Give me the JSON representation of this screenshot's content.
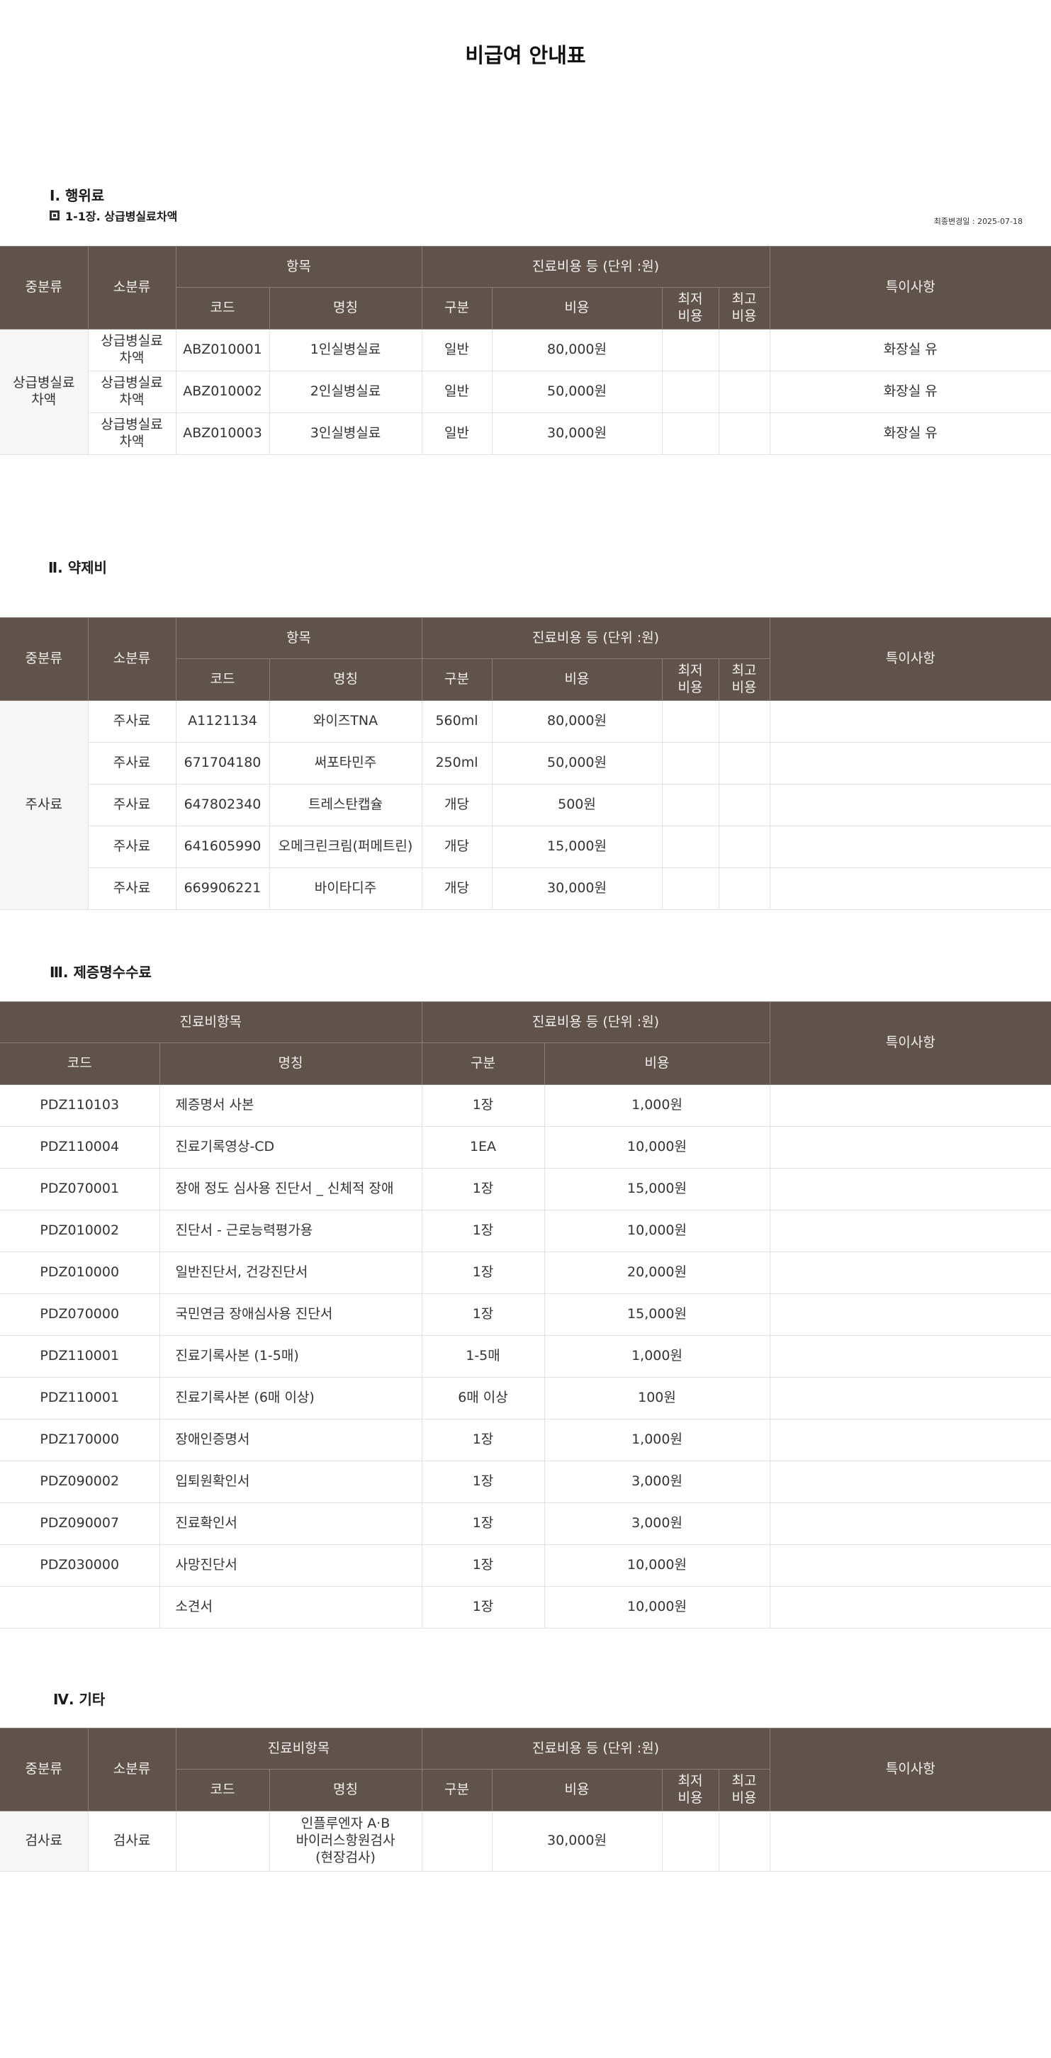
{
  "title": "비급여 안내표",
  "updated": "최종변경일 : 2025-07-18",
  "sec1": {
    "heading": "Ⅰ. 행위료",
    "sub": "1-1장. 상급병실료차액",
    "h": {
      "mid": "중분류",
      "small": "소분류",
      "item": "항목",
      "cost": "진료비용 등 (단위 :원)",
      "note": "특이사항",
      "code": "코드",
      "name": "명칭",
      "div": "구분",
      "price": "비용",
      "min": "최저\n비용",
      "max": "최고\n비용"
    },
    "group": "상급병실료\n차액",
    "rows": [
      {
        "small": "상급병실료\n차액",
        "code": "ABZ010001",
        "name": "1인실병실료",
        "div": "일반",
        "price": "80,000원",
        "note": "화장실 유"
      },
      {
        "small": "상급병실료\n차액",
        "code": "ABZ010002",
        "name": "2인실병실료",
        "div": "일반",
        "price": "50,000원",
        "note": "화장실 유"
      },
      {
        "small": "상급병실료\n차액",
        "code": "ABZ010003",
        "name": "3인실병실료",
        "div": "일반",
        "price": "30,000원",
        "note": "화장실 유"
      }
    ]
  },
  "sec2": {
    "heading": "Ⅱ. 약제비",
    "h": {
      "mid": "중분류",
      "small": "소분류",
      "item": "항목",
      "cost": "진료비용 등 (단위 :원)",
      "note": "특이사항",
      "code": "코드",
      "name": "명칭",
      "div": "구분",
      "price": "비용",
      "min": "최저\n비용",
      "max": "최고\n비용"
    },
    "group": "주사료",
    "rows": [
      {
        "small": "주사료",
        "code": "A1121134",
        "name": "와이즈TNA",
        "div": "560ml",
        "price": "80,000원"
      },
      {
        "small": "주사료",
        "code": "671704180",
        "name": "써포타민주",
        "div": "250ml",
        "price": "50,000원"
      },
      {
        "small": "주사료",
        "code": "647802340",
        "name": "트레스탄캡슐",
        "div": "개당",
        "price": "500원"
      },
      {
        "small": "주사료",
        "code": "641605990",
        "name": "오메크린크림(퍼메트린)",
        "div": "개당",
        "price": "15,000원"
      },
      {
        "small": "주사료",
        "code": "669906221",
        "name": "바이타디주",
        "div": "개당",
        "price": "30,000원"
      }
    ]
  },
  "sec3": {
    "heading": "Ⅲ. 제증명수수료",
    "h": {
      "item": "진료비항목",
      "cost": "진료비용 등 (단위 :원)",
      "note": "특이사항",
      "code": "코드",
      "name": "명칭",
      "div": "구분",
      "price": "비용"
    },
    "rows": [
      {
        "code": "PDZ110103",
        "name": "제증명서 사본",
        "div": "1장",
        "price": "1,000원"
      },
      {
        "code": "PDZ110004",
        "name": "진료기록영상-CD",
        "div": "1EA",
        "price": "10,000원"
      },
      {
        "code": "PDZ070001",
        "name": "장애 정도 심사용 진단서 _ 신체적 장애",
        "div": "1장",
        "price": "15,000원"
      },
      {
        "code": "PDZ010002",
        "name": "진단서 - 근로능력평가용",
        "div": "1장",
        "price": "10,000원"
      },
      {
        "code": "PDZ010000",
        "name": "일반진단서, 건강진단서",
        "div": "1장",
        "price": "20,000원"
      },
      {
        "code": "PDZ070000",
        "name": "국민연금 장애심사용 진단서",
        "div": "1장",
        "price": "15,000원"
      },
      {
        "code": "PDZ110001",
        "name": "진료기록사본 (1-5매)",
        "div": "1-5매",
        "price": "1,000원"
      },
      {
        "code": "PDZ110001",
        "name": "진료기록사본 (6매 이상)",
        "div": "6매 이상",
        "price": "100원"
      },
      {
        "code": "PDZ170000",
        "name": "장애인증명서",
        "div": "1장",
        "price": "1,000원"
      },
      {
        "code": "PDZ090002",
        "name": "입퇴원확인서",
        "div": "1장",
        "price": "3,000원"
      },
      {
        "code": "PDZ090007",
        "name": "진료확인서",
        "div": "1장",
        "price": "3,000원"
      },
      {
        "code": "PDZ030000",
        "name": "사망진단서",
        "div": "1장",
        "price": "10,000원"
      },
      {
        "code": "",
        "name": "소견서",
        "div": "1장",
        "price": "10,000원"
      }
    ]
  },
  "sec4": {
    "heading": "Ⅳ. 기타",
    "h": {
      "mid": "중분류",
      "small": "소분류",
      "item": "진료비항목",
      "cost": "진료비용 등 (단위 :원)",
      "note": "특이사항",
      "code": "코드",
      "name": "명칭",
      "div": "구분",
      "price": "비용",
      "min": "최저\n비용",
      "max": "최고\n비용"
    },
    "rows": [
      {
        "mid": "검사료",
        "small": "검사료",
        "code": "",
        "name": "인플루엔자 A·B\n바이러스항원검사\n(현장검사)",
        "div": "",
        "price": "30,000원"
      }
    ]
  }
}
